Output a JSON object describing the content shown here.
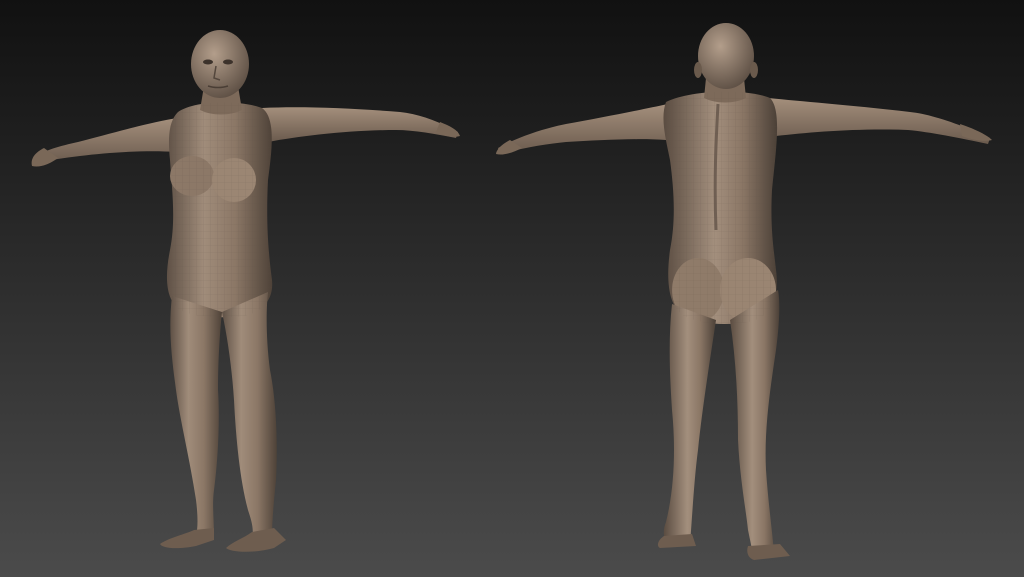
{
  "scene": {
    "description_visible_text": "",
    "colors": {
      "background_top": "#111111",
      "background_bottom": "#4b4b4b",
      "skin_base": "#8d7a69",
      "skin_highlight": "#b5a18f",
      "skin_shadow": "#4e4238",
      "wireframe": "#5a4e44"
    }
  }
}
